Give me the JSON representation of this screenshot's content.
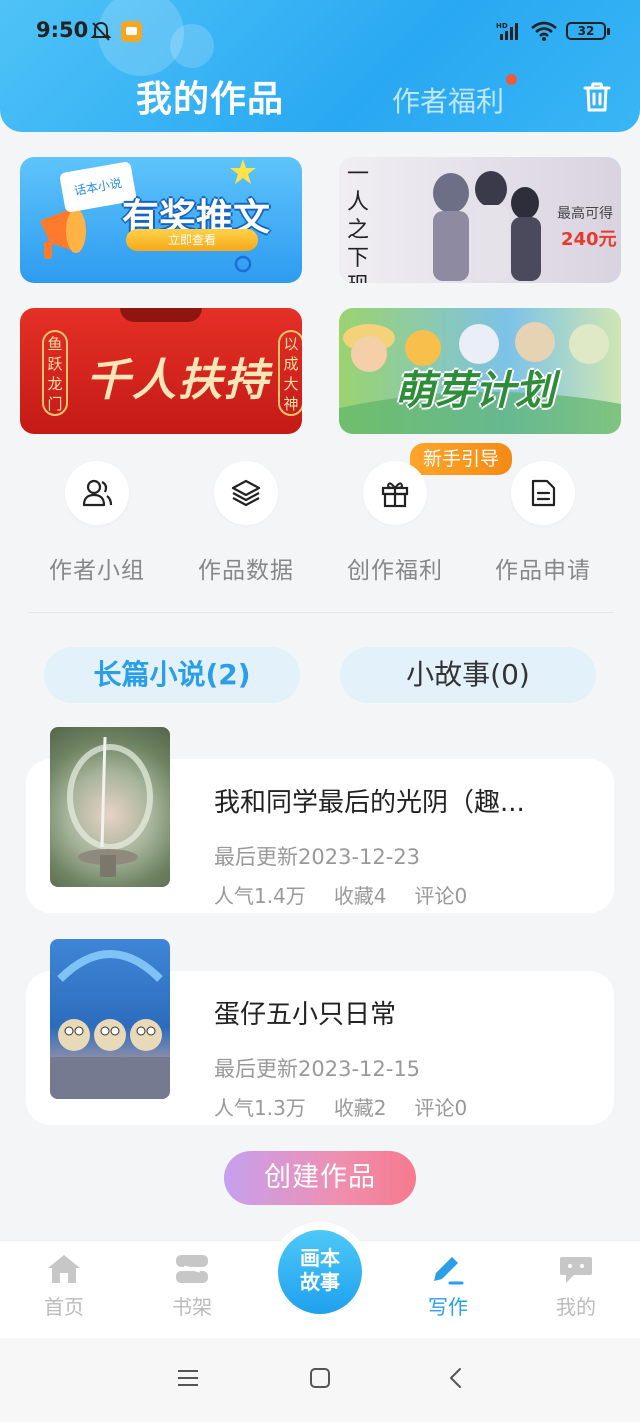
{
  "status_bar": {
    "time": "9:50",
    "battery": "32"
  },
  "header": {
    "title": "我的作品",
    "author_welfare_tab": "作者福利"
  },
  "banners": [
    {
      "tag": "话本小说",
      "title": "有奖推文",
      "button": "立即查看"
    },
    {
      "vertical_title": "一人之下现金扶持",
      "prize_label": "最高可得",
      "prize_value": "240元"
    },
    {
      "title": "千人扶持",
      "left_couplet": "鱼跃龙门",
      "right_couplet": "以成大神"
    },
    {
      "title": "萌芽计划"
    }
  ],
  "guide_badge": "新手引导",
  "quick_actions": [
    {
      "label": "作者小组",
      "icon": "users-icon"
    },
    {
      "label": "作品数据",
      "icon": "layers-icon"
    },
    {
      "label": "创作福利",
      "icon": "gift-icon"
    },
    {
      "label": "作品申请",
      "icon": "document-icon"
    }
  ],
  "categories": [
    {
      "label": "长篇小说(2)",
      "active": true
    },
    {
      "label": "小故事(0)",
      "active": false
    }
  ],
  "works": [
    {
      "title": "我和同学最后的光阴（趣...",
      "updated": "最后更新2023-12-23",
      "popularity": "人气1.4万",
      "favorites": "收藏4",
      "comments": "评论0"
    },
    {
      "title": "蛋仔五小只日常",
      "updated": "最后更新2023-12-15",
      "popularity": "人气1.3万",
      "favorites": "收藏2",
      "comments": "评论0"
    }
  ],
  "create_button": "创建作品",
  "bottom_nav": {
    "home": "首页",
    "bookshelf": "书架",
    "center_line1": "画本",
    "center_line2": "故事",
    "write": "写作",
    "me": "我的"
  },
  "colors": {
    "accent": "#2a9ee8",
    "header": "#29a8f2",
    "badge": "#f58a16"
  }
}
